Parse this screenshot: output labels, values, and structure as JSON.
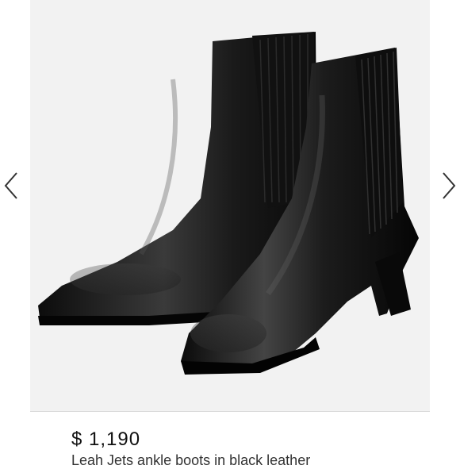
{
  "product": {
    "price": "$ 1,190",
    "description": "Leah Jets ankle boots in black leather",
    "image_alt": "Black leather ankle boots"
  },
  "gallery": {
    "prev_icon": "chevron-left-icon",
    "next_icon": "chevron-right-icon"
  },
  "colors": {
    "photo_bg": "#f2f2f2",
    "leather": "#141414",
    "price_text": "#111111"
  }
}
